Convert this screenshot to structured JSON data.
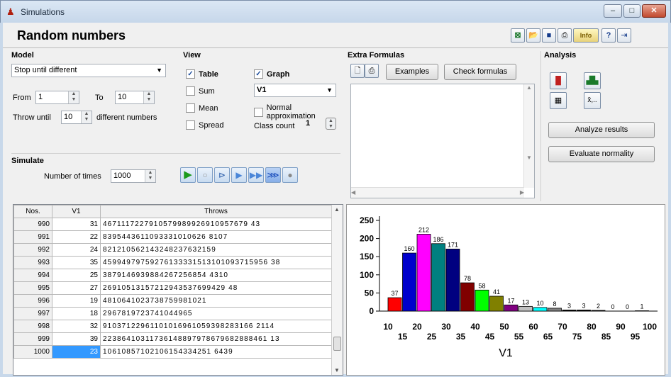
{
  "window": {
    "title": "Simulations"
  },
  "main": {
    "title": "Random numbers"
  },
  "model": {
    "header": "Model",
    "mode": "Stop until different",
    "from_label": "From",
    "from": "1",
    "to_label": "To",
    "to": "10",
    "throw_until_label": "Throw until",
    "throw_until": "10",
    "different_label": "different numbers"
  },
  "view": {
    "header": "View",
    "table": "Table",
    "graph": "Graph",
    "sum": "Sum",
    "mean": "Mean",
    "spread": "Spread",
    "variable": "V1",
    "normal_approx": "Normal approximation",
    "class_count_label": "Class count",
    "class_count": "1"
  },
  "simulate": {
    "header": "Simulate",
    "times_label": "Number of times",
    "times": "1000"
  },
  "extra": {
    "header": "Extra Formulas",
    "examples": "Examples",
    "check": "Check formulas"
  },
  "analysis": {
    "header": "Analysis",
    "xbar": "x̄,..",
    "analyze": "Analyze results",
    "normality": "Evaluate normality"
  },
  "table": {
    "headers": [
      "Nos.",
      "V1",
      "Throws"
    ],
    "rows": [
      {
        "n": "990",
        "v": "31",
        "t": "4671117227910579989926910957679 43"
      },
      {
        "n": "991",
        "v": "22",
        "t": "8395443611093331010626 8107"
      },
      {
        "n": "992",
        "v": "24",
        "t": "821210562143248237632159"
      },
      {
        "n": "993",
        "v": "35",
        "t": "45994979759276133331513101093715956 38"
      },
      {
        "n": "994",
        "v": "25",
        "t": "3879146939884267256854 4310"
      },
      {
        "n": "995",
        "v": "27",
        "t": "26910513157212943537699429 48"
      },
      {
        "n": "996",
        "v": "19",
        "t": "4810641023738759981021"
      },
      {
        "n": "997",
        "v": "18",
        "t": "2967819723741044965"
      },
      {
        "n": "998",
        "v": "32",
        "t": "91037122961101016961059398283166 2114"
      },
      {
        "n": "999",
        "v": "39",
        "t": "22386410311736148897978679682888461 13"
      },
      {
        "n": "1000",
        "v": "23",
        "t": "10610857102106154334251 6439"
      }
    ]
  },
  "chart_data": {
    "type": "bar",
    "title": "",
    "xlabel": "V1",
    "ylabel": "",
    "ylim": [
      0,
      250
    ],
    "yticks": [
      "0",
      "50",
      "100",
      "150",
      "200",
      "250"
    ],
    "xticks_top": [
      "10",
      "20",
      "30",
      "40",
      "50",
      "60",
      "70",
      "80",
      "90",
      "100"
    ],
    "xticks_bottom": [
      "15",
      "25",
      "35",
      "45",
      "55",
      "65",
      "75",
      "85",
      "95"
    ],
    "categories": [
      "10-15",
      "15-20",
      "20-25",
      "25-30",
      "30-35",
      "35-40",
      "40-45",
      "45-50",
      "50-55",
      "55-60",
      "60-65",
      "65-70",
      "70-75",
      "75-80",
      "80-85",
      "85-90",
      "90-95",
      "95-100"
    ],
    "values": [
      37,
      160,
      212,
      186,
      171,
      78,
      58,
      41,
      17,
      13,
      10,
      8,
      3,
      3,
      2,
      0,
      0,
      1
    ],
    "colors": [
      "#ff0000",
      "#0000cc",
      "#ff00ff",
      "#008080",
      "#000080",
      "#800000",
      "#00ff00",
      "#808000",
      "#800080",
      "#c0c0c0",
      "#00ffff",
      "#808080",
      "#000000",
      "#000000",
      "#000000",
      "#000000",
      "#000000",
      "#000000"
    ]
  }
}
